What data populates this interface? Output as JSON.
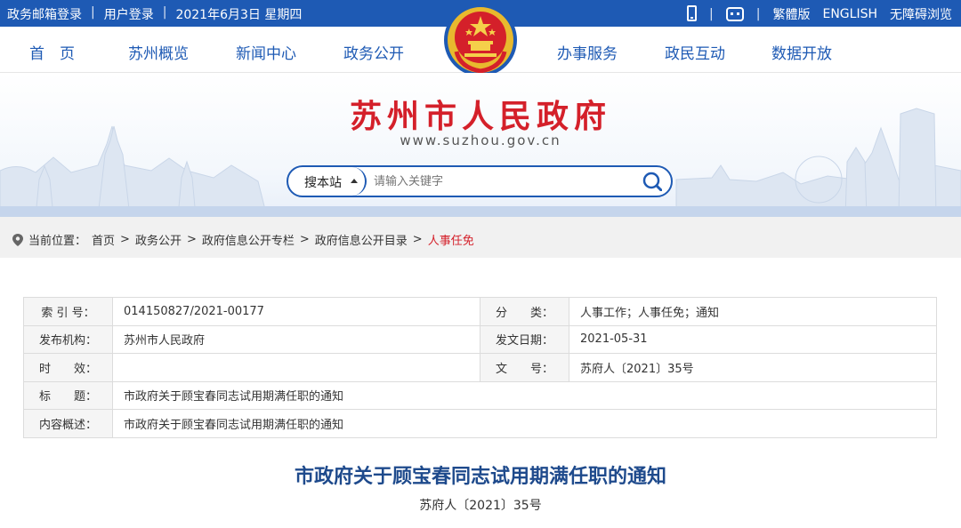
{
  "topbar": {
    "left": [
      "政务邮箱登录",
      "用户登录",
      "2021年6月3日 星期四"
    ],
    "sep": "|",
    "right": [
      "繁體版",
      "ENGLISH",
      "无障碍浏览"
    ],
    "icons": [
      "phone-icon",
      "robot-icon"
    ]
  },
  "nav": {
    "items": [
      "首　页",
      "苏州概览",
      "新闻中心",
      "政务公开",
      "办事服务",
      "政民互动",
      "数据开放"
    ],
    "active": "政务公开"
  },
  "banner": {
    "title": "苏州市人民政府",
    "url": "www.suzhou.gov.cn",
    "search_scope": "搜本站",
    "search_placeholder": "请输入关键字"
  },
  "breadcrumb": {
    "label": "当前位置：",
    "items": [
      "首页",
      "政务公开",
      "政府信息公开专栏",
      "政府信息公开目录",
      "人事任免"
    ],
    "sep": ">"
  },
  "info_table": {
    "rows": [
      [
        {
          "label": "索 引 号：",
          "value": "014150827/2021-00177"
        },
        {
          "label": "分　　类：",
          "value": "人事工作；人事任免；通知"
        }
      ],
      [
        {
          "label": "发布机构：",
          "value": "苏州市人民政府"
        },
        {
          "label": "发文日期：",
          "value": "2021-05-31"
        }
      ],
      [
        {
          "label": "时　　效：",
          "value": ""
        },
        {
          "label": "文　　号：",
          "value": "苏府人〔2021〕35号"
        }
      ],
      [
        {
          "label": "标　　题：",
          "value": "市政府关于顾宝春同志试用期满任职的通知"
        }
      ],
      [
        {
          "label": "内容概述：",
          "value": "市政府关于顾宝春同志试用期满任职的通知"
        }
      ]
    ]
  },
  "document": {
    "title": "市政府关于顾宝春同志试用期满任职的通知",
    "number": "苏府人〔2021〕35号"
  },
  "colors": {
    "brand_blue": "#1e5ab4",
    "title_red": "#d4202a",
    "doc_title": "#1e4a8c"
  }
}
